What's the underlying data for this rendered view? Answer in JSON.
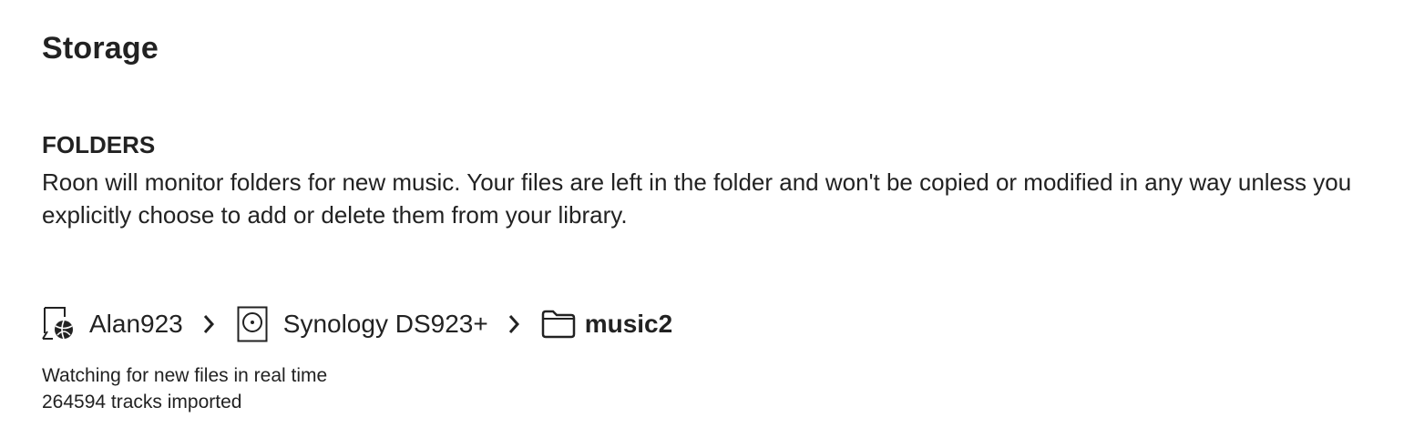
{
  "page": {
    "title": "Storage"
  },
  "folders_section": {
    "heading": "FOLDERS",
    "description": "Roon will monitor folders for new music. Your files are left in the folder and won't be copied or modified in any way unless you explicitly choose to add or delete them from your library."
  },
  "breadcrumb": {
    "items": [
      {
        "label": "Alan923",
        "icon": "network-computer-icon"
      },
      {
        "label": "Synology DS923+",
        "icon": "hard-drive-icon"
      },
      {
        "label": "music2",
        "icon": "folder-icon"
      }
    ],
    "separator_icon": "chevron-right-icon"
  },
  "status": {
    "watch_status": "Watching for new files in real time",
    "tracks_imported": "264594 tracks imported"
  }
}
